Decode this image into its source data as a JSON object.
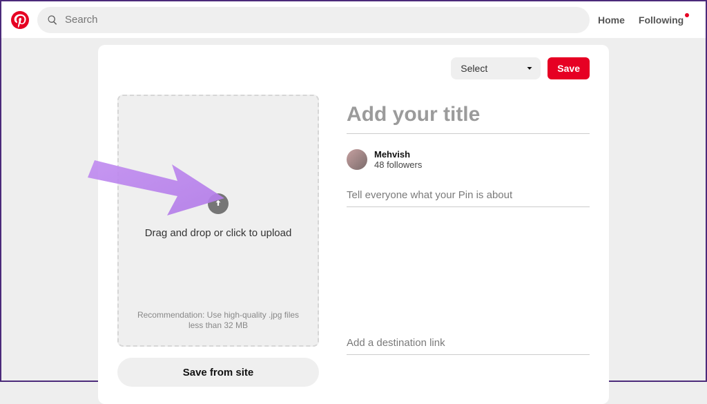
{
  "search": {
    "placeholder": "Search"
  },
  "nav": {
    "home": "Home",
    "following": "Following"
  },
  "builder": {
    "board_select_label": "Select",
    "save_label": "Save",
    "title_placeholder": "Add your title",
    "description_placeholder": "Tell everyone what your Pin is about",
    "link_placeholder": "Add a destination link",
    "drop_text": "Drag and drop or click to upload",
    "recommendation_text": "Recommendation: Use high-quality .jpg files less than 32 MB",
    "save_from_site_label": "Save from site"
  },
  "user": {
    "name": "Mehvish",
    "followers_text": "48 followers"
  }
}
